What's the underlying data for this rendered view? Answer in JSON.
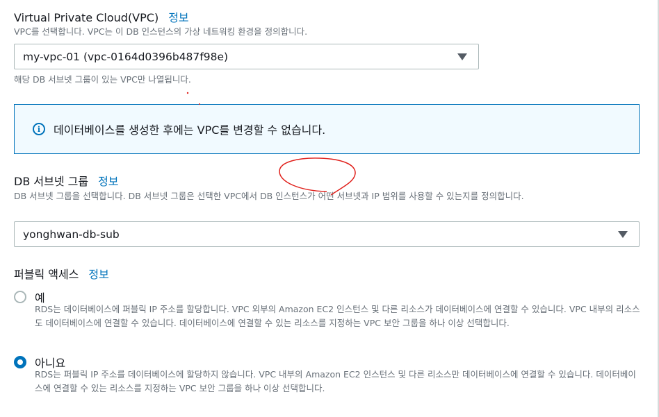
{
  "vpc": {
    "label": "Virtual Private Cloud(VPC)",
    "info": "정보",
    "description": "VPC를 선택합니다. VPC는 이 DB 인스턴스의 가상 네트워킹 환경을 정의합니다.",
    "selected": "my-vpc-01 (vpc-0164d0396b487f98e)",
    "hint": "해당 DB 서브넷 그룹이 있는 VPC만 나열됩니다."
  },
  "alert": {
    "icon": "info-icon",
    "text": "데이터베이스를 생성한 후에는 VPC를 변경할 수 없습니다."
  },
  "subnet": {
    "label": "DB 서브넷 그룹",
    "info": "정보",
    "description": "DB 서브넷 그룹을 선택합니다. DB 서브넷 그룹은 선택한 VPC에서 DB 인스턴스가 어떤 서브넷과 IP 범위를 사용할 수 있는지를 정의합니다.",
    "selected": "yonghwan-db-sub"
  },
  "public_access": {
    "label": "퍼블릭 액세스",
    "info": "정보",
    "options": [
      {
        "label": "예",
        "checked": false,
        "description": "RDS는 데이터베이스에 퍼블릭 IP 주소를 할당합니다. VPC 외부의 Amazon EC2 인스턴스 및 다른 리소스가 데이터베이스에 연결할 수 있습니다. VPC 내부의 리소스도 데이터베이스에 연결할 수 있습니다. 데이터베이스에 연결할 수 있는 리소스를 지정하는 VPC 보안 그룹을 하나 이상 선택합니다."
      },
      {
        "label": "아니요",
        "checked": true,
        "description": "RDS는 퍼블릭 IP 주소를 데이터베이스에 할당하지 않습니다. VPC 내부의 Amazon EC2 인스턴스 및 다른 리소스만 데이터베이스에 연결할 수 있습니다. 데이터베이스에 연결할 수 있는 리소스를 지정하는 VPC 보안 그룹을 하나 이상 선택합니다."
      }
    ]
  },
  "colors": {
    "link": "#0073bb",
    "annotation": "#e0201b"
  }
}
